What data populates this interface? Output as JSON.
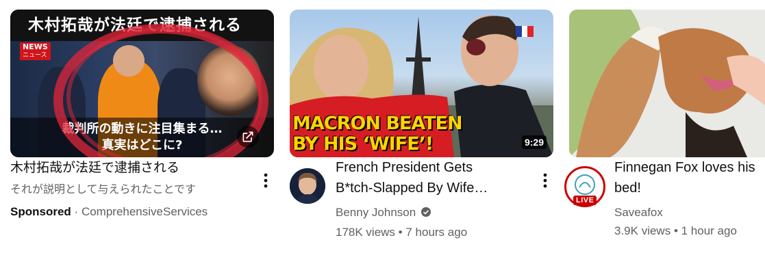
{
  "videos": [
    {
      "thumb_title": "木村拓哉が法廷で逮捕される",
      "thumb_news": "NEWS",
      "thumb_news_sub": "ニュース",
      "thumb_caption_line1": "裁判所の動きに注目集まる…",
      "thumb_caption_line2": "真実はどこに?",
      "title": "木村拓哉が法廷で逮捕される",
      "description": "それが説明として与えられたことです",
      "sponsored_label": "Sponsored",
      "separator": "·",
      "advertiser": "ComprehensiveServices"
    },
    {
      "thumb_line1": "MACRON BEATEN",
      "thumb_line2": "BY HIS ‘WIFE’!",
      "duration": "9:29",
      "title_line1": "French President Gets",
      "title_line2": "B*tch-Slapped By Wife…",
      "channel": "Benny Johnson",
      "views": "178K views",
      "separator": "•",
      "age": "7 hours ago"
    },
    {
      "title_line1": "Finnegan Fox loves his",
      "title_line2": "bed!",
      "live_badge": "LIVE",
      "channel": "Saveafox",
      "views": "3.9K views",
      "separator": "•",
      "age": "1 hour ago"
    }
  ],
  "icons": {
    "menu": "more-vert-icon",
    "external": "open-in-new-icon",
    "verified": "verified-check-icon"
  },
  "colors": {
    "live_red": "#cc0000",
    "secondary_text": "#606060",
    "yellow_text": "#ffd400"
  }
}
